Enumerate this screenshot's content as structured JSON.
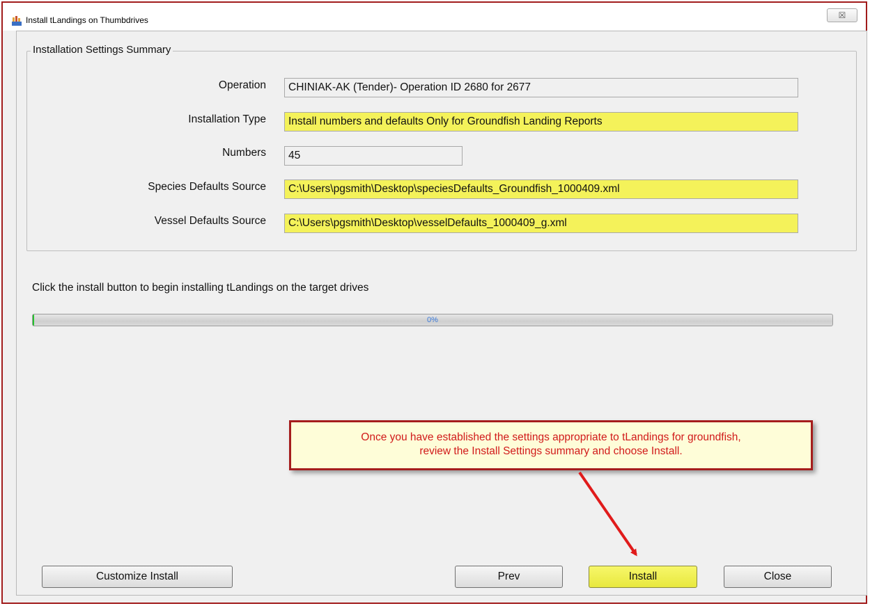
{
  "window": {
    "title": "Install tLandings on Thumbdrives",
    "close_glyph": "☒"
  },
  "settings_summary": {
    "group_title": "Installation Settings Summary",
    "rows": [
      {
        "label": "Operation",
        "value": "CHINIAK-AK (Tender)- Operation ID 2680 for 2677"
      },
      {
        "label": "Installation Type",
        "value": "Install numbers and defaults Only for Groundfish Landing Reports"
      },
      {
        "label": "Numbers",
        "value": "45"
      },
      {
        "label": "Species Defaults Source",
        "value": "C:\\Users\\pgsmith\\Desktop\\speciesDefaults_Groundfish_1000409.xml"
      },
      {
        "label": "Vessel Defaults Source",
        "value": "C:\\Users\\pgsmith\\Desktop\\vesselDefaults_1000409_g.xml"
      }
    ]
  },
  "instruction_text": "Click the install button to begin installing tLandings on the target drives",
  "progress": {
    "percent": 0,
    "label": "0%"
  },
  "callout": {
    "line1": "Once you have established the settings appropriate to tLandings for groundfish,",
    "line2": "review the Install Settings summary and choose Install."
  },
  "buttons": {
    "customize": "Customize Install",
    "prev": "Prev",
    "install": "Install",
    "close": "Close"
  },
  "colors": {
    "highlight": "#f4f25a",
    "callout_border": "#a51d1d",
    "callout_text": "#d11a1a",
    "frame_border": "#a11b1b",
    "progress_text": "#3b7ad9"
  }
}
